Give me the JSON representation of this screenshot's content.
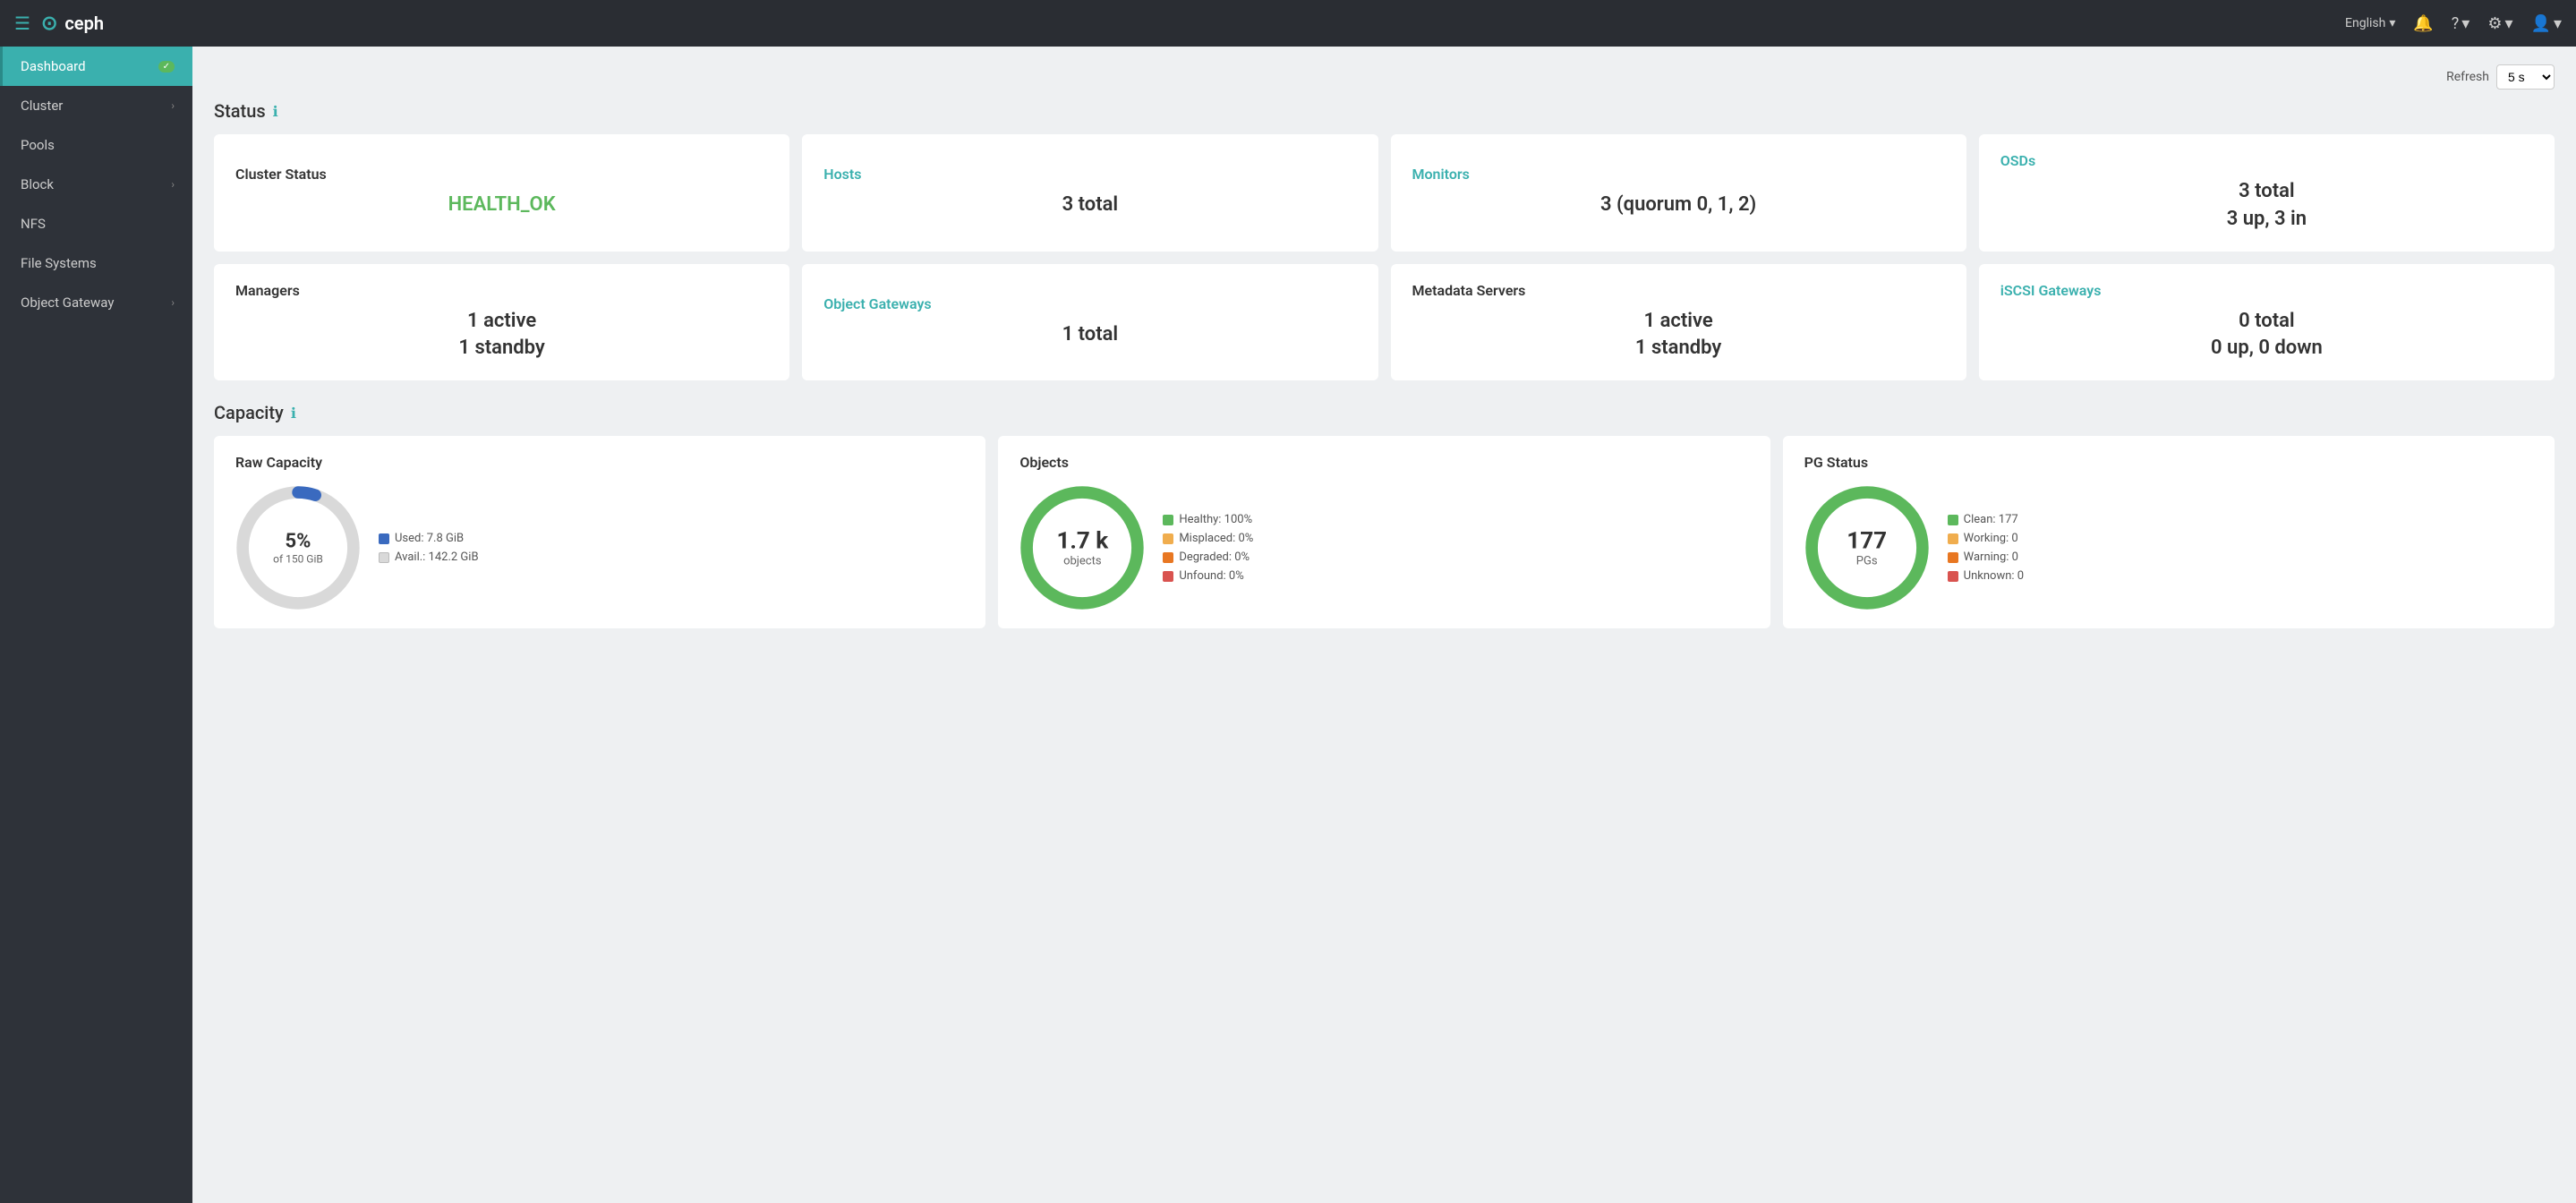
{
  "topnav": {
    "logo_text": "ceph",
    "lang": "English",
    "lang_dropdown": "▾",
    "bell_icon": "🔔",
    "question_icon": "?",
    "gear_icon": "⚙",
    "user_icon": "👤"
  },
  "sidebar": {
    "items": [
      {
        "id": "dashboard",
        "label": "Dashboard",
        "active": true,
        "badge": "✓",
        "has_chevron": false
      },
      {
        "id": "cluster",
        "label": "Cluster",
        "active": false,
        "has_chevron": true
      },
      {
        "id": "pools",
        "label": "Pools",
        "active": false,
        "has_chevron": false
      },
      {
        "id": "block",
        "label": "Block",
        "active": false,
        "has_chevron": true
      },
      {
        "id": "nfs",
        "label": "NFS",
        "active": false,
        "has_chevron": false
      },
      {
        "id": "filesystems",
        "label": "File Systems",
        "active": false,
        "has_chevron": false
      },
      {
        "id": "objectgateway",
        "label": "Object Gateway",
        "active": false,
        "has_chevron": true
      }
    ]
  },
  "refresh": {
    "label": "Refresh",
    "value": "5 s"
  },
  "status_section": {
    "title": "Status",
    "cards": [
      {
        "id": "cluster-status",
        "title": "Cluster Status",
        "title_is_link": false,
        "value": "HEALTH_OK",
        "value_color": "green",
        "sub_value": ""
      },
      {
        "id": "hosts",
        "title": "Hosts",
        "title_is_link": true,
        "value": "3 total",
        "value_color": "normal",
        "sub_value": ""
      },
      {
        "id": "monitors",
        "title": "Monitors",
        "title_is_link": true,
        "value": "3 (quorum 0, 1, 2)",
        "value_color": "normal",
        "sub_value": ""
      },
      {
        "id": "osds",
        "title": "OSDs",
        "title_is_link": true,
        "value": "3 total",
        "sub_value": "3 up, 3 in",
        "value_color": "normal"
      },
      {
        "id": "managers",
        "title": "Managers",
        "title_is_link": false,
        "value": "1 active",
        "sub_value": "1 standby",
        "value_color": "normal"
      },
      {
        "id": "object-gateways",
        "title": "Object Gateways",
        "title_is_link": true,
        "value": "1 total",
        "sub_value": "",
        "value_color": "normal"
      },
      {
        "id": "metadata-servers",
        "title": "Metadata Servers",
        "title_is_link": false,
        "value": "1 active",
        "sub_value": "1 standby",
        "value_color": "normal"
      },
      {
        "id": "iscsi-gateways",
        "title": "iSCSI Gateways",
        "title_is_link": true,
        "value": "0 total",
        "sub_value": "0 up, 0 down",
        "value_color": "normal"
      }
    ]
  },
  "capacity_section": {
    "title": "Capacity",
    "raw_capacity": {
      "title": "Raw Capacity",
      "percent": "5%",
      "of_label": "of 150 GiB",
      "used_label": "Used: 7.8 GiB",
      "avail_label": "Avail.: 142.2 GiB",
      "used_color": "#3a6abf",
      "avail_color": "#d9d9d9",
      "used_pct": 5
    },
    "objects": {
      "title": "Objects",
      "count": "1.7 k",
      "label": "objects",
      "healthy_pct": "100%",
      "misplaced_pct": "0%",
      "degraded_pct": "0%",
      "unfound_pct": "0%",
      "healthy_color": "#5cb85c",
      "misplaced_color": "#f0ad4e",
      "degraded_color": "#e87722",
      "unfound_color": "#d9534f"
    },
    "pg_status": {
      "title": "PG Status",
      "count": "177",
      "label": "PGs",
      "clean": "177",
      "working": "0",
      "warning": "0",
      "unknown": "0",
      "clean_color": "#5cb85c",
      "working_color": "#f0ad4e",
      "warning_color": "#e87722",
      "unknown_color": "#d9534f"
    }
  }
}
